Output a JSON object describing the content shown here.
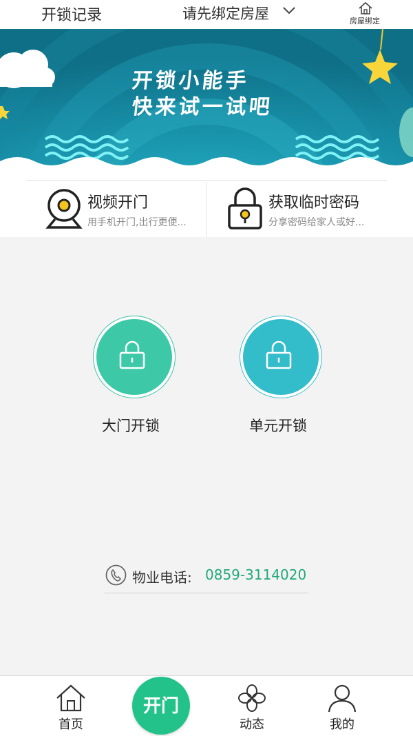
{
  "header": {
    "left_title": "开锁记录",
    "center_title": "请先绑定房屋",
    "right_label": "房屋绑定"
  },
  "banner": {
    "line1": "开锁小能手",
    "line2": "快来试一试吧"
  },
  "features": [
    {
      "title": "视频开门",
      "subtitle": "用手机开门,出行更便..."
    },
    {
      "title": "获取临时密码",
      "subtitle": "分享密码给家人或好..."
    }
  ],
  "locks": [
    {
      "label": "大门开锁"
    },
    {
      "label": "单元开锁"
    }
  ],
  "property": {
    "label": "物业电话:",
    "phone": "0859-3114020"
  },
  "nav": {
    "home": "首页",
    "open": "开门",
    "activity": "动态",
    "mine": "我的"
  },
  "colors": {
    "accent_green": "#23c28a",
    "gate_color": "#3dc9a7",
    "unit_color": "#33bcc9",
    "banner_bg": "#1a8fa8",
    "phone_color": "#22a87a"
  },
  "icons": [
    "chevron-down-icon",
    "house-icon",
    "camera-icon",
    "padlock-icon",
    "lock-icon",
    "phone-icon",
    "home-icon",
    "clover-icon",
    "person-icon"
  ]
}
